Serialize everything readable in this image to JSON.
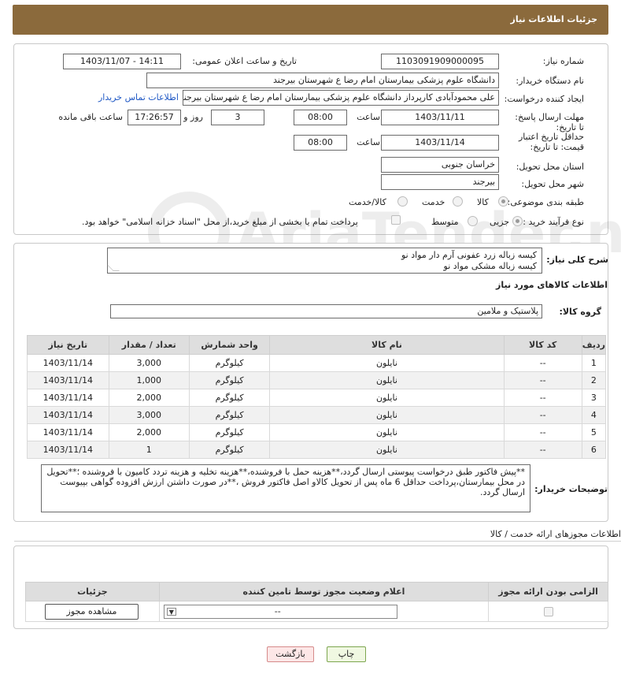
{
  "header": {
    "title": "جزئیات اطلاعات نیاز"
  },
  "form": {
    "need_number_label": "شماره نیاز:",
    "need_number": "1103091909000095",
    "announce_label": "تاریخ و ساعت اعلان عمومی:",
    "announce_value": "1403/11/07 - 14:11",
    "buyer_org_label": "نام دستگاه خریدار:",
    "buyer_org": "دانشگاه علوم پزشکی  بیمارستان امام رضا ع  شهرستان بیرجند",
    "creator_label": "ایجاد کننده درخواست:",
    "creator": "علی محمودآبادی کارپرداز دانشگاه علوم پزشکی  بیمارستان امام رضا ع  شهرستان بیرجند",
    "contact_link": "اطلاعات تماس خریدار",
    "deadline_label": "مهلت ارسال پاسخ: تا تاریخ:",
    "deadline_date": "1403/11/11",
    "time_label": "ساعت",
    "deadline_time": "08:00",
    "days_value": "3",
    "days_label": "روز و",
    "remain_time": "17:26:57",
    "remain_label": "ساعت باقی مانده",
    "min_validity_label": "حداقل تاریخ اعتبار قیمت: تا تاریخ:",
    "validity_date": "1403/11/14",
    "validity_time": "08:00",
    "province_label": "استان محل تحویل:",
    "province": "خراسان جنوبی",
    "city_label": "شهر محل تحویل:",
    "city": "بیرجند",
    "category_label": "طبقه بندی موضوعی:",
    "category_options": [
      "کالا",
      "خدمت",
      "کالا/خدمت"
    ],
    "purchase_type_label": "نوع فرآیند خرید :",
    "purchase_options": [
      "جزیی",
      "متوسط"
    ],
    "payment_note": "پرداخت تمام یا بخشی از مبلغ خرید،از محل \"اسناد خزانه اسلامی\" خواهد بود."
  },
  "description": {
    "label": "شرح کلی نیاز:",
    "lines": [
      "کیسه زباله زرد عفونی آرم دار مواد نو",
      "کیسه زباله مشکی مواد نو"
    ]
  },
  "goods": {
    "section_title": "اطلاعات کالاهای مورد نیاز",
    "group_label": "گروه کالا:",
    "group_value": "پلاستیک و ملامین",
    "columns": [
      "ردیف",
      "کد کالا",
      "نام کالا",
      "واحد شمارش",
      "تعداد / مقدار",
      "تاریخ نیاز"
    ],
    "rows": [
      [
        "1",
        "--",
        "نایلون",
        "کیلوگرم",
        "3,000",
        "1403/11/14"
      ],
      [
        "2",
        "--",
        "نایلون",
        "کیلوگرم",
        "1,000",
        "1403/11/14"
      ],
      [
        "3",
        "--",
        "نایلون",
        "کیلوگرم",
        "2,000",
        "1403/11/14"
      ],
      [
        "4",
        "--",
        "نایلون",
        "کیلوگرم",
        "3,000",
        "1403/11/14"
      ],
      [
        "5",
        "--",
        "نایلون",
        "کیلوگرم",
        "2,000",
        "1403/11/14"
      ],
      [
        "6",
        "--",
        "نایلون",
        "کیلوگرم",
        "1",
        "1403/11/14"
      ]
    ]
  },
  "buyer_notes": {
    "label": "توضیحات خریدار:",
    "text": "**پیش فاکتور طبق درخواست پیوستی ارسال گردد،**هزینه حمل با فروشنده،**هزینه تخلیه و هزینه تردد کامیون با فروشنده ؛**تحویل در محل بیمارستان،پرداخت حداقل 6 ماه پس از تحویل کالاو اصل فاکتور فروش ،**در صورت داشتن ارزش افزوده گواهی بپیوست ارسال گردد."
  },
  "permits": {
    "section_title": "اطلاعات مجوزهای ارائه خدمت / کالا",
    "columns": [
      "الزامی بودن ارائه مجوز",
      "اعلام وضعیت مجوز توسط تامین کننده",
      "جزئیات"
    ],
    "select_value": "--",
    "view_button": "مشاهده مجوز"
  },
  "buttons": {
    "print": "چاپ",
    "back": "بازگشت"
  },
  "watermark_text": "AriaTender.neT"
}
